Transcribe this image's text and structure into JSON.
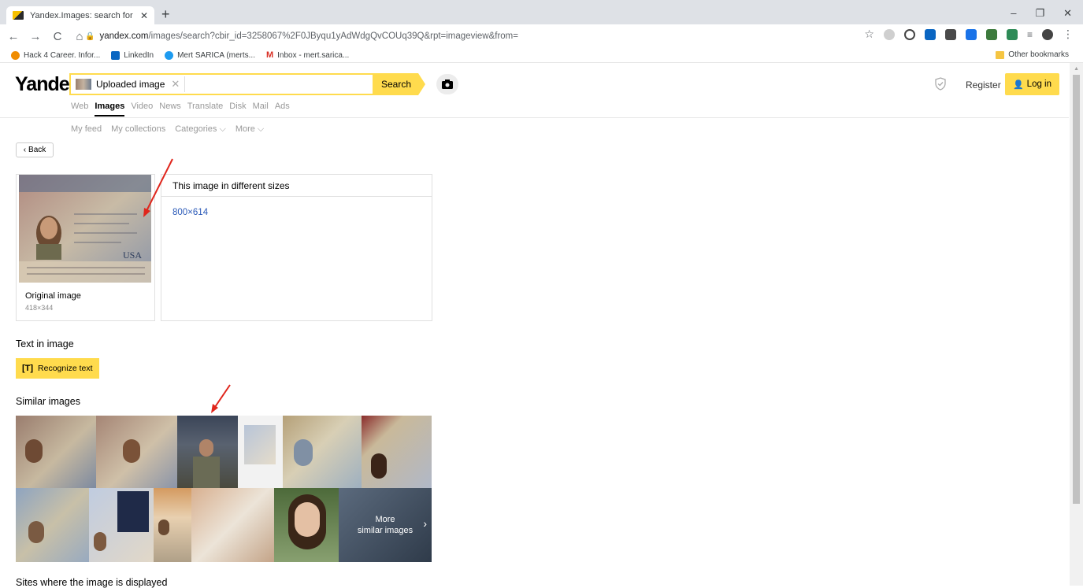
{
  "browser": {
    "tab_title": "Yandex.Images: search for image",
    "tab_close": "✕",
    "new_tab": "+",
    "win_minimize": "–",
    "win_restore": "❐",
    "win_close": "✕",
    "nav_back": "←",
    "nav_forward": "→",
    "nav_reload": "C",
    "nav_home": "⌂",
    "url_host": "yandex.com",
    "url_path": "/images/search?cbir_id=3258067%2F0JByqu1yAdWdgQvCOUq39Q&rpt=imageview&from=",
    "star": "☆",
    "menu": "⋮"
  },
  "bookmarks": [
    {
      "label": "Hack 4 Career. Infor...",
      "color": "#f08c00"
    },
    {
      "label": "LinkedIn",
      "color": "#0a66c2"
    },
    {
      "label": "Mert SARICA (merts...",
      "color": "#1d9bf0"
    },
    {
      "label": "Inbox - mert.sarica...",
      "color": "#d93025"
    }
  ],
  "other_bookmarks": "Other bookmarks",
  "yandex": {
    "logo": "Yandex",
    "search_chip": "Uploaded image",
    "search_chip_close": "✕",
    "search_button": "Search",
    "register": "Register",
    "login": "Log in",
    "services": [
      "Web",
      "Images",
      "Video",
      "News",
      "Translate",
      "Disk",
      "Mail",
      "Ads"
    ],
    "active_service": "Images",
    "subnav": [
      "My feed",
      "My collections",
      "Categories ⌵",
      "More ⌵"
    ],
    "back": "Back"
  },
  "original": {
    "title": "Original image",
    "size": "418×344"
  },
  "sizes": {
    "title": "This image in different sizes",
    "link": "800×614"
  },
  "text_in_image": {
    "heading": "Text in image",
    "button": "Recognize text"
  },
  "similar": {
    "heading": "Similar images",
    "more_line1": "More",
    "more_line2": "similar images"
  },
  "sites": {
    "heading": "Sites where the image is displayed"
  },
  "colors": {
    "accent": "#ffdb4d",
    "link": "#2b5ab8",
    "annotation_arrow": "#e0261c"
  }
}
